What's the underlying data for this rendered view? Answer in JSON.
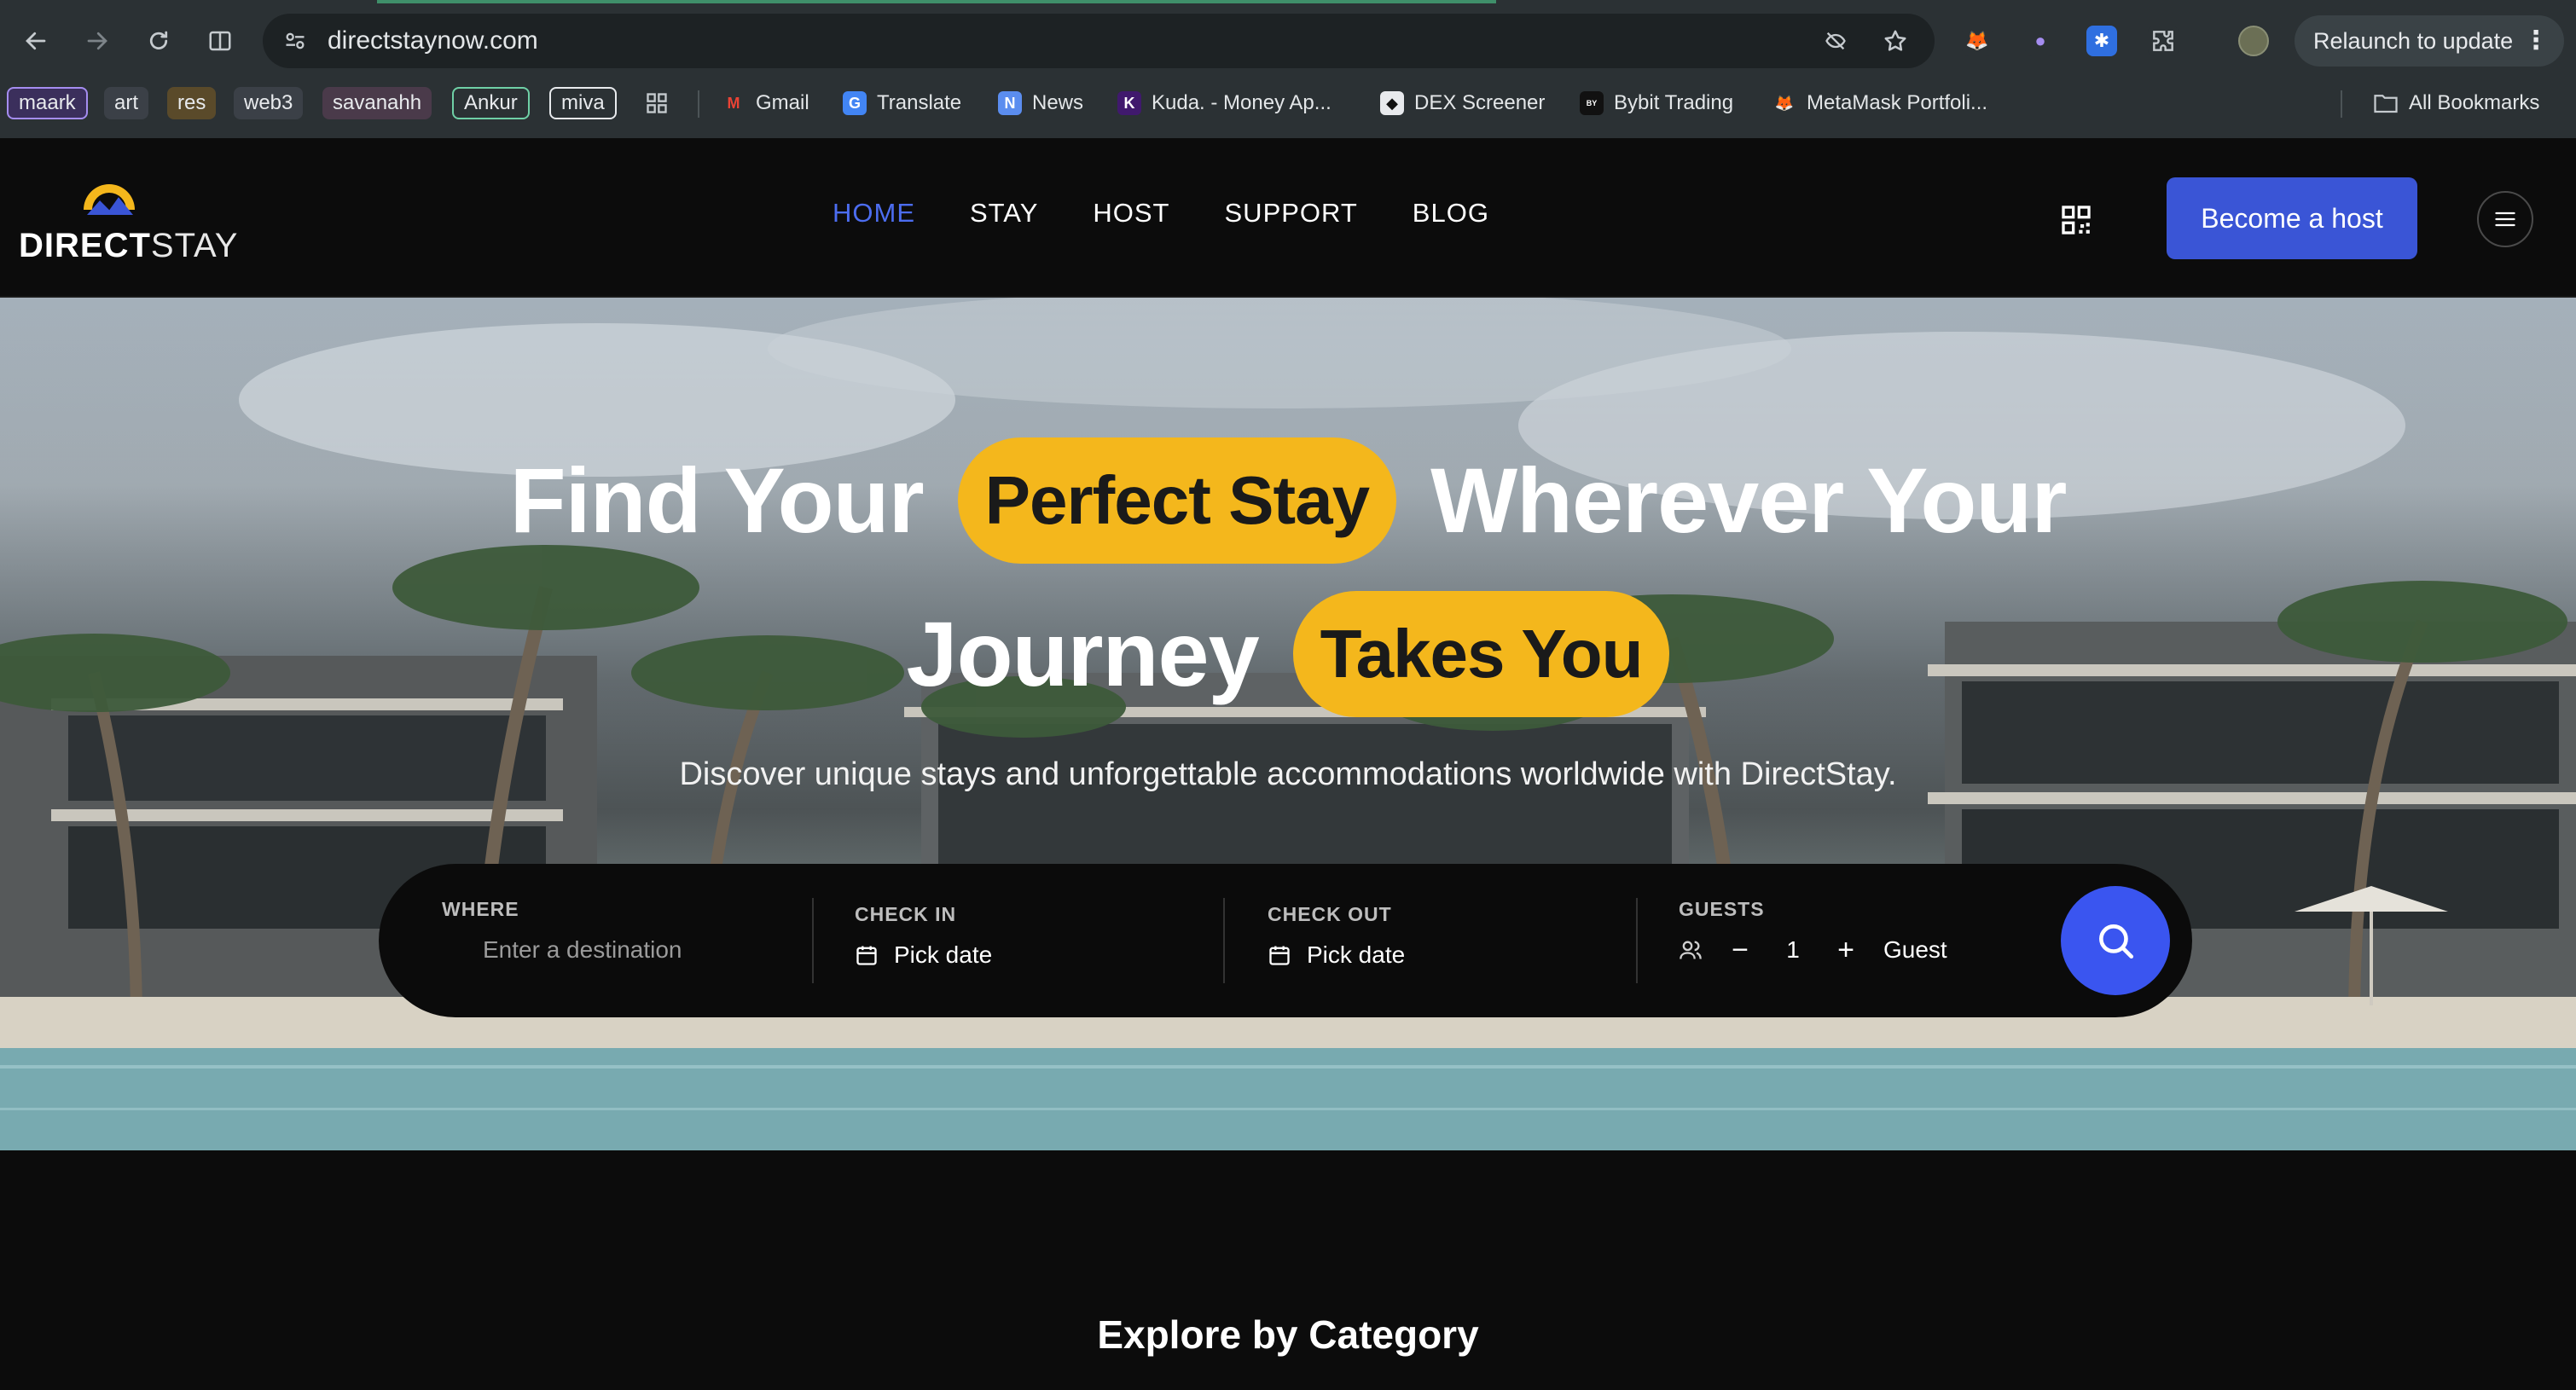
{
  "browser": {
    "url": "directstaynow.com",
    "relaunch_label": "Relaunch to update",
    "bookmark_groups": [
      {
        "label": "maark",
        "color": "#3b2f5c",
        "border": "#a58df0"
      },
      {
        "label": "art",
        "color": "#3b4047",
        "border": "#3b4047"
      },
      {
        "label": "res",
        "color": "#5a4a2a",
        "border": "#5a4a2a"
      },
      {
        "label": "web3",
        "color": "#3b4047",
        "border": "#3b4047"
      },
      {
        "label": "savanahh",
        "color": "#4a3a4a",
        "border": "#4a3a4a"
      },
      {
        "label": "Ankur",
        "color": "#2b3134",
        "border": "#6fd0a6"
      },
      {
        "label": "miva",
        "color": "#2b3134",
        "border": "#e8eaed"
      }
    ],
    "bookmarks": [
      {
        "label": "Gmail",
        "icon": "gmail-icon"
      },
      {
        "label": "Translate",
        "icon": "translate-icon"
      },
      {
        "label": "News",
        "icon": "news-icon"
      },
      {
        "label": "Kuda. - Money Ap...",
        "icon": "kuda-icon"
      },
      {
        "label": "DEX Screener",
        "icon": "dex-icon"
      },
      {
        "label": "Bybit Trading",
        "icon": "bybit-icon"
      },
      {
        "label": "MetaMask Portfoli...",
        "icon": "metamask-icon"
      }
    ],
    "all_bookmarks_label": "All Bookmarks"
  },
  "site": {
    "logo": {
      "bold": "DIRECT",
      "light": "STAY"
    },
    "nav": [
      {
        "label": "HOME",
        "active": true
      },
      {
        "label": "STAY",
        "active": false
      },
      {
        "label": "HOST",
        "active": false
      },
      {
        "label": "SUPPORT",
        "active": false
      },
      {
        "label": "BLOG",
        "active": false
      }
    ],
    "host_button": "Become a host",
    "accent": "#3a55d6",
    "highlight": "#f4b71c"
  },
  "hero": {
    "line1_a": "Find Your",
    "line1_pill": "Perfect Stay",
    "line1_b": "Wherever Your",
    "line2_a": "Journey",
    "line2_pill": "Takes You",
    "subtitle": "Discover unique stays and unforgettable accommodations worldwide with DirectStay."
  },
  "search": {
    "where_label": "WHERE",
    "where_placeholder": "Enter a destination",
    "checkin_label": "CHECK IN",
    "checkin_value": "Pick date",
    "checkout_label": "CHECK OUT",
    "checkout_value": "Pick date",
    "guests_label": "GUESTS",
    "guests_count": "1",
    "guests_unit": "Guest"
  },
  "sections": {
    "explore_title": "Explore by Category"
  }
}
